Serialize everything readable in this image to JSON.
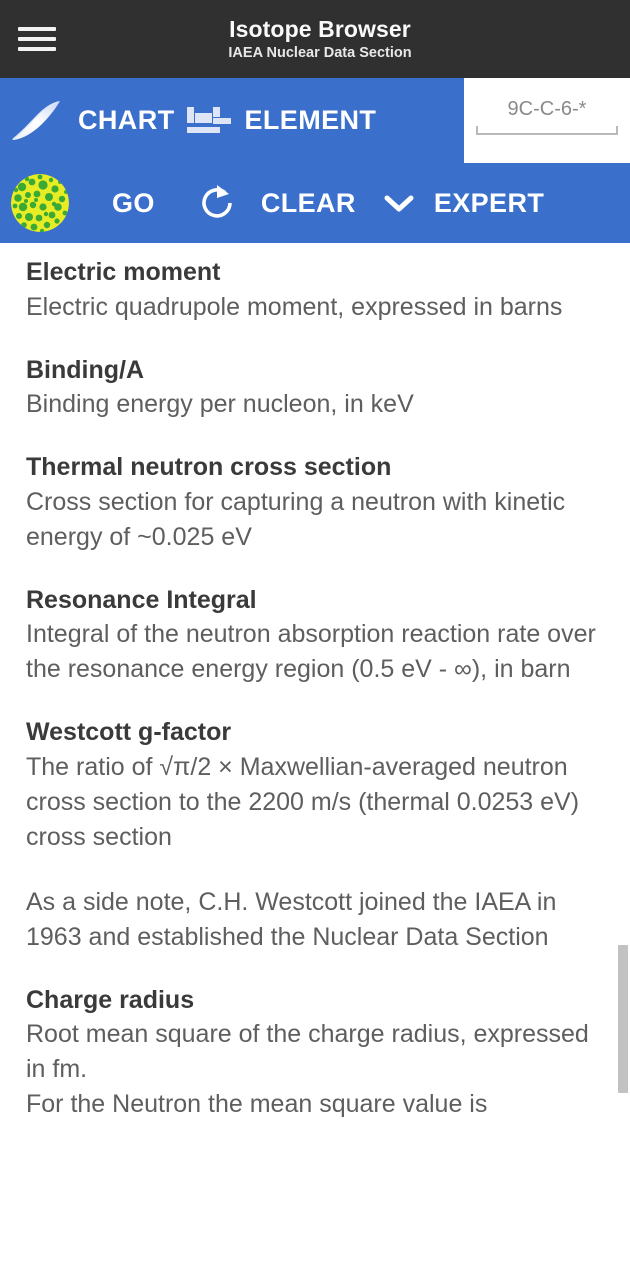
{
  "appbar": {
    "menu_icon": "hamburger-menu-icon",
    "title": "Isotope Browser",
    "subtitle": "IAEA Nuclear Data Section"
  },
  "toolbar_primary": {
    "chart_icon": "chart-of-nuclides-icon",
    "chart_label": "CHART",
    "element_icon": "periodic-table-icon",
    "element_label": "ELEMENT"
  },
  "search": {
    "value": "",
    "placeholder": "9C-C-6-*"
  },
  "toolbar_secondary": {
    "nucleus_icon": "nucleus-icon",
    "go_label": "GO",
    "refresh_icon": "refresh-icon",
    "clear_label": "CLEAR",
    "chevron_icon": "chevron-down-icon",
    "expert_label": "EXPERT"
  },
  "colors": {
    "appbar_background": "#303030",
    "toolbar_background": "#3a6fcb",
    "content_background": "#ffffff",
    "term_text": "#3a3a3a",
    "definition_text": "#5e5e5e",
    "scrollbar_thumb": "#c2c2c2",
    "nucleus_green": "#3aaa35",
    "nucleus_yellow": "#e8ec25"
  },
  "content": {
    "entries": [
      {
        "term": "Electric moment",
        "definition": "Electric quadrupole moment, expressed in barns"
      },
      {
        "term": "Binding/A",
        "definition": "Binding energy per nucleon, in keV"
      },
      {
        "term": "Thermal neutron cross section",
        "definition": "Cross section for capturing a neutron with kinetic energy of ~0.025 eV"
      },
      {
        "term": "Resonance Integral",
        "definition": "Integral of the neutron absorption reaction rate over the resonance energy region (0.5 eV - ∞), in barn"
      },
      {
        "term": "Westcott g-factor",
        "definition": "The ratio of √π/2 × Maxwellian-averaged neutron cross section to the 2200 m/s (thermal 0.0253 eV) cross section"
      }
    ],
    "side_note": "As a side note, C.H. Westcott joined the IAEA in 1963 and established the Nuclear Data Section",
    "last_entry": {
      "term": "Charge radius",
      "definition": "Root mean square of the charge radius, expressed in fm.\nFor the Neutron the mean square value is"
    }
  }
}
